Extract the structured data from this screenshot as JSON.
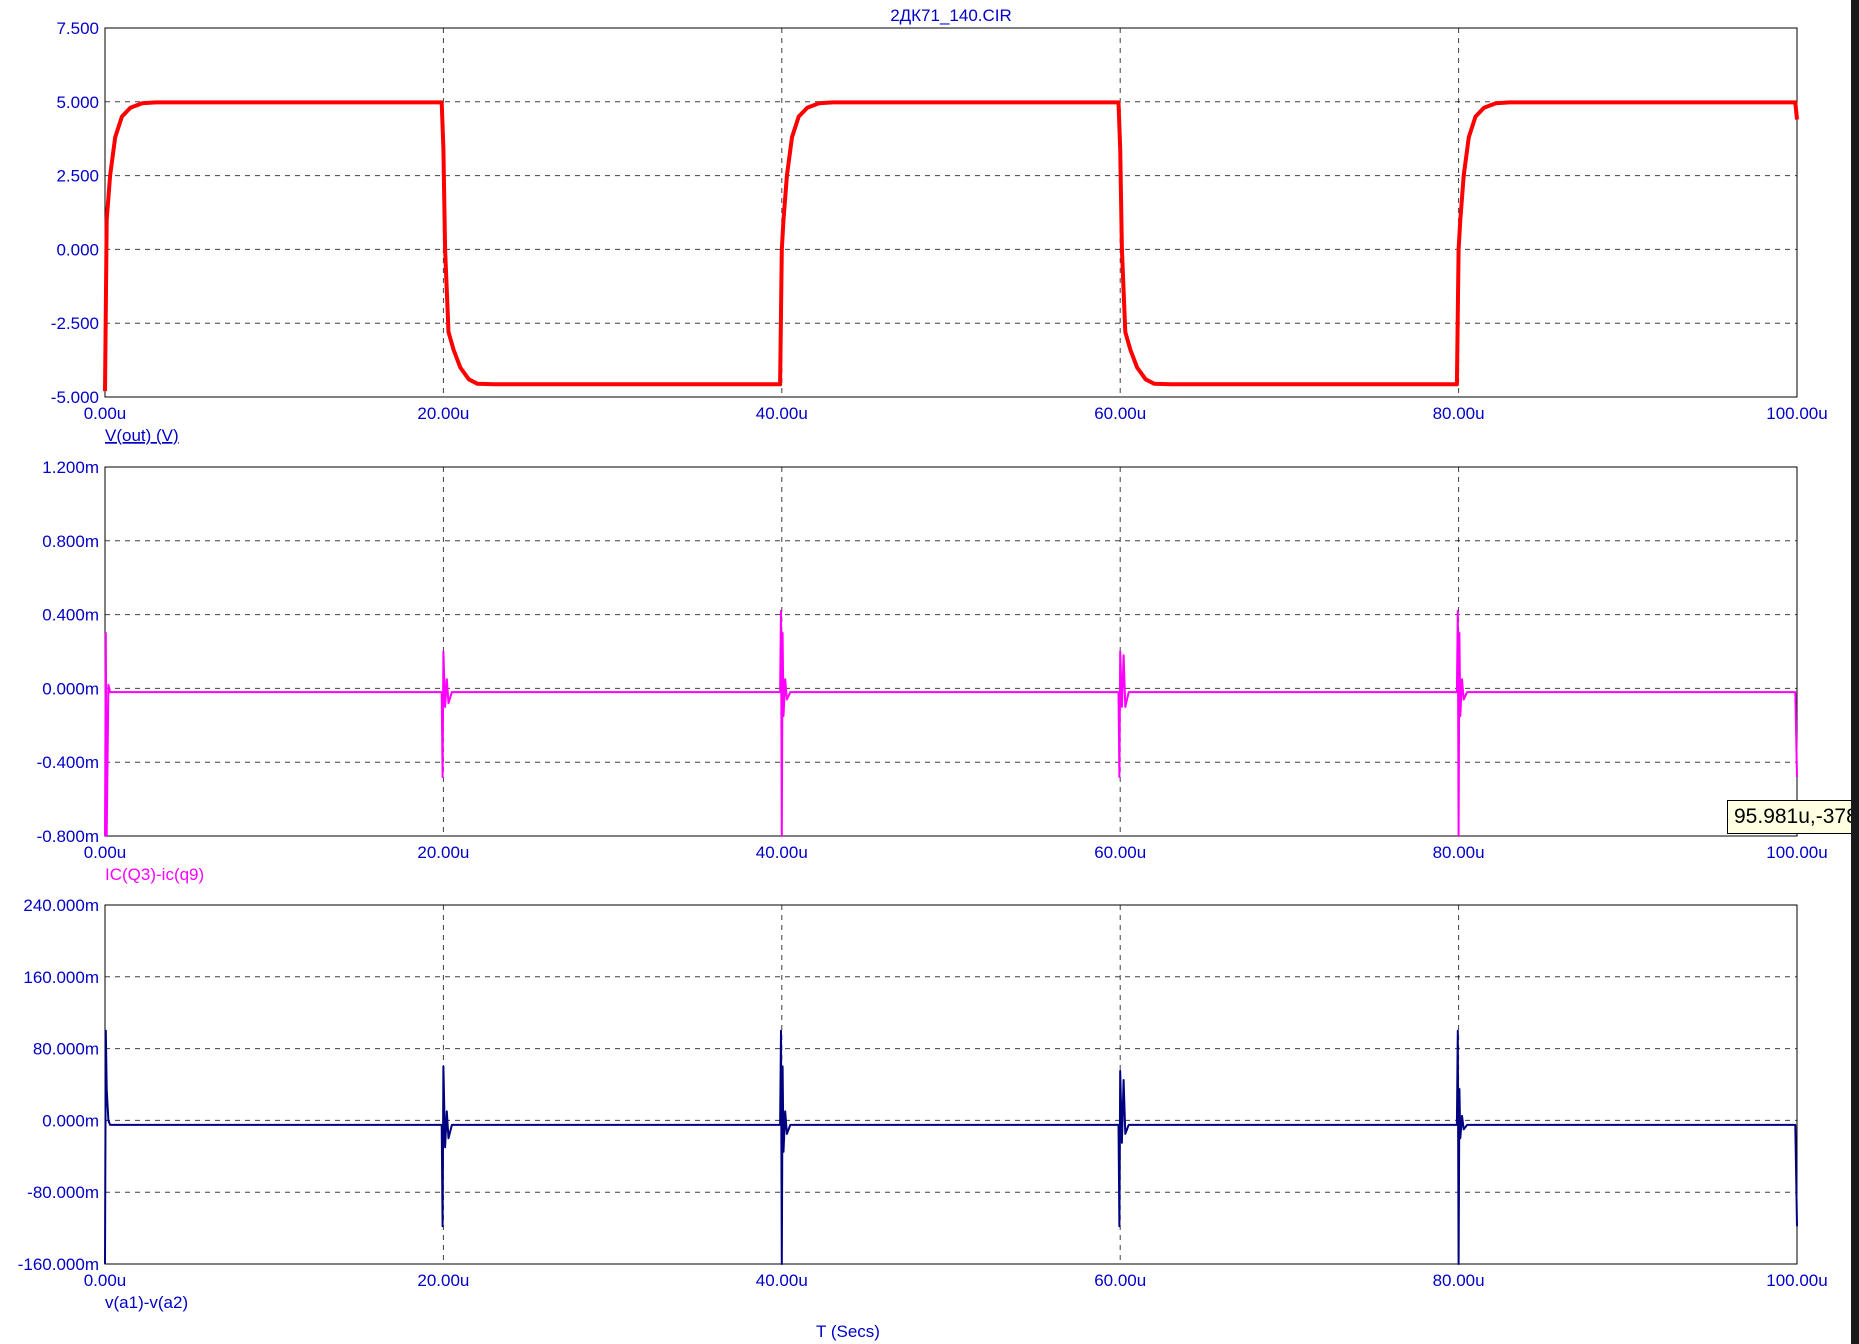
{
  "window": {
    "title": "2ДК71_140.CIR"
  },
  "tooltip": {
    "text": "95.981u,-378"
  },
  "x_axis_title": "T (Secs)",
  "chart_data": [
    {
      "type": "line",
      "series_label": "V(out) (V)",
      "color": "#ff0000",
      "x_ticks": [
        "0.00u",
        "20.00u",
        "40.00u",
        "60.00u",
        "80.00u",
        "100.00u"
      ],
      "y_ticks": [
        "7.500",
        "5.000",
        "2.500",
        "0.000",
        "-2.500",
        "-5.000"
      ],
      "xlim": [
        0,
        100
      ],
      "ylim": [
        -5,
        7.5
      ],
      "grid": true,
      "x": [
        0,
        0.1,
        0.3,
        0.6,
        1.0,
        1.5,
        2.2,
        3.0,
        19.9,
        20.0,
        20.1,
        20.3,
        20.6,
        21.0,
        21.5,
        22.0,
        23.0,
        39.9,
        40.0,
        40.1,
        40.3,
        40.6,
        41.0,
        41.5,
        42.2,
        43.0,
        59.9,
        60.0,
        60.1,
        60.3,
        60.6,
        61.0,
        61.5,
        62.0,
        63.0,
        79.9,
        80.0,
        80.1,
        80.3,
        80.6,
        81.0,
        81.5,
        82.2,
        83.0,
        99.9,
        100.0
      ],
      "y": [
        -4.8,
        1.0,
        2.5,
        3.8,
        4.5,
        4.8,
        4.95,
        4.98,
        4.98,
        3.4,
        0.0,
        -2.8,
        -3.4,
        -4.0,
        -4.4,
        -4.55,
        -4.57,
        -4.57,
        0.0,
        1.0,
        2.5,
        3.8,
        4.5,
        4.8,
        4.95,
        4.98,
        4.98,
        3.4,
        0.0,
        -2.8,
        -3.4,
        -4.0,
        -4.4,
        -4.55,
        -4.57,
        -4.57,
        0.0,
        1.0,
        2.5,
        3.8,
        4.5,
        4.8,
        4.95,
        4.98,
        4.98,
        4.4
      ]
    },
    {
      "type": "line",
      "series_label": "IC(Q3)-ic(q9)",
      "color": "#ff00ff",
      "x_ticks": [
        "0.00u",
        "20.00u",
        "40.00u",
        "60.00u",
        "80.00u",
        "100.00u"
      ],
      "y_ticks": [
        "1.200m",
        "0.800m",
        "0.400m",
        "0.000m",
        "-0.400m",
        "-0.800m"
      ],
      "xlim": [
        0,
        100
      ],
      "ylim": [
        -0.8,
        1.2
      ],
      "grid": true,
      "x": [
        0,
        0.05,
        0.1,
        0.2,
        0.3,
        0.5,
        19.9,
        19.95,
        20.0,
        20.1,
        20.2,
        20.3,
        20.5,
        39.9,
        39.95,
        40.0,
        40.05,
        40.1,
        40.2,
        40.3,
        40.5,
        59.9,
        59.95,
        60.0,
        60.1,
        60.2,
        60.3,
        60.5,
        79.9,
        79.95,
        80.0,
        80.05,
        80.1,
        80.2,
        80.3,
        80.5,
        99.9,
        100.0
      ],
      "y": [
        -0.8,
        0.3,
        -0.8,
        0.02,
        -0.02,
        -0.02,
        -0.02,
        -0.48,
        0.2,
        -0.1,
        0.05,
        -0.08,
        -0.02,
        -0.02,
        0.42,
        -0.8,
        0.3,
        -0.15,
        0.05,
        -0.06,
        -0.02,
        -0.02,
        -0.48,
        0.2,
        -0.1,
        0.18,
        -0.1,
        -0.02,
        -0.02,
        0.42,
        -0.8,
        0.3,
        -0.15,
        0.05,
        -0.06,
        -0.02,
        -0.02,
        -0.48
      ]
    },
    {
      "type": "line",
      "series_label": "v(a1)-v(a2)",
      "color": "#000080",
      "x_ticks": [
        "0.00u",
        "20.00u",
        "40.00u",
        "60.00u",
        "80.00u",
        "100.00u"
      ],
      "y_ticks": [
        "240.000m",
        "160.000m",
        "80.000m",
        "0.000m",
        "-80.000m",
        "-160.000m"
      ],
      "xlim": [
        0,
        100
      ],
      "ylim": [
        -160,
        240
      ],
      "grid": true,
      "x": [
        0,
        0.05,
        0.1,
        0.2,
        0.3,
        0.5,
        19.9,
        19.95,
        20.0,
        20.1,
        20.2,
        20.3,
        20.5,
        39.9,
        39.95,
        40.0,
        40.05,
        40.1,
        40.2,
        40.3,
        40.5,
        59.9,
        59.95,
        60.0,
        60.1,
        60.2,
        60.3,
        60.5,
        79.9,
        79.95,
        80.0,
        80.05,
        80.1,
        80.2,
        80.3,
        80.5,
        99.9,
        100.0
      ],
      "y": [
        -160,
        100,
        35,
        0,
        -5,
        -5,
        -5,
        -118,
        60,
        -30,
        10,
        -20,
        -5,
        -5,
        100,
        -160,
        60,
        -35,
        10,
        -15,
        -5,
        -5,
        -118,
        55,
        -25,
        45,
        -15,
        -5,
        -5,
        100,
        -160,
        35,
        -20,
        5,
        -10,
        -5,
        -5,
        -118
      ]
    }
  ]
}
